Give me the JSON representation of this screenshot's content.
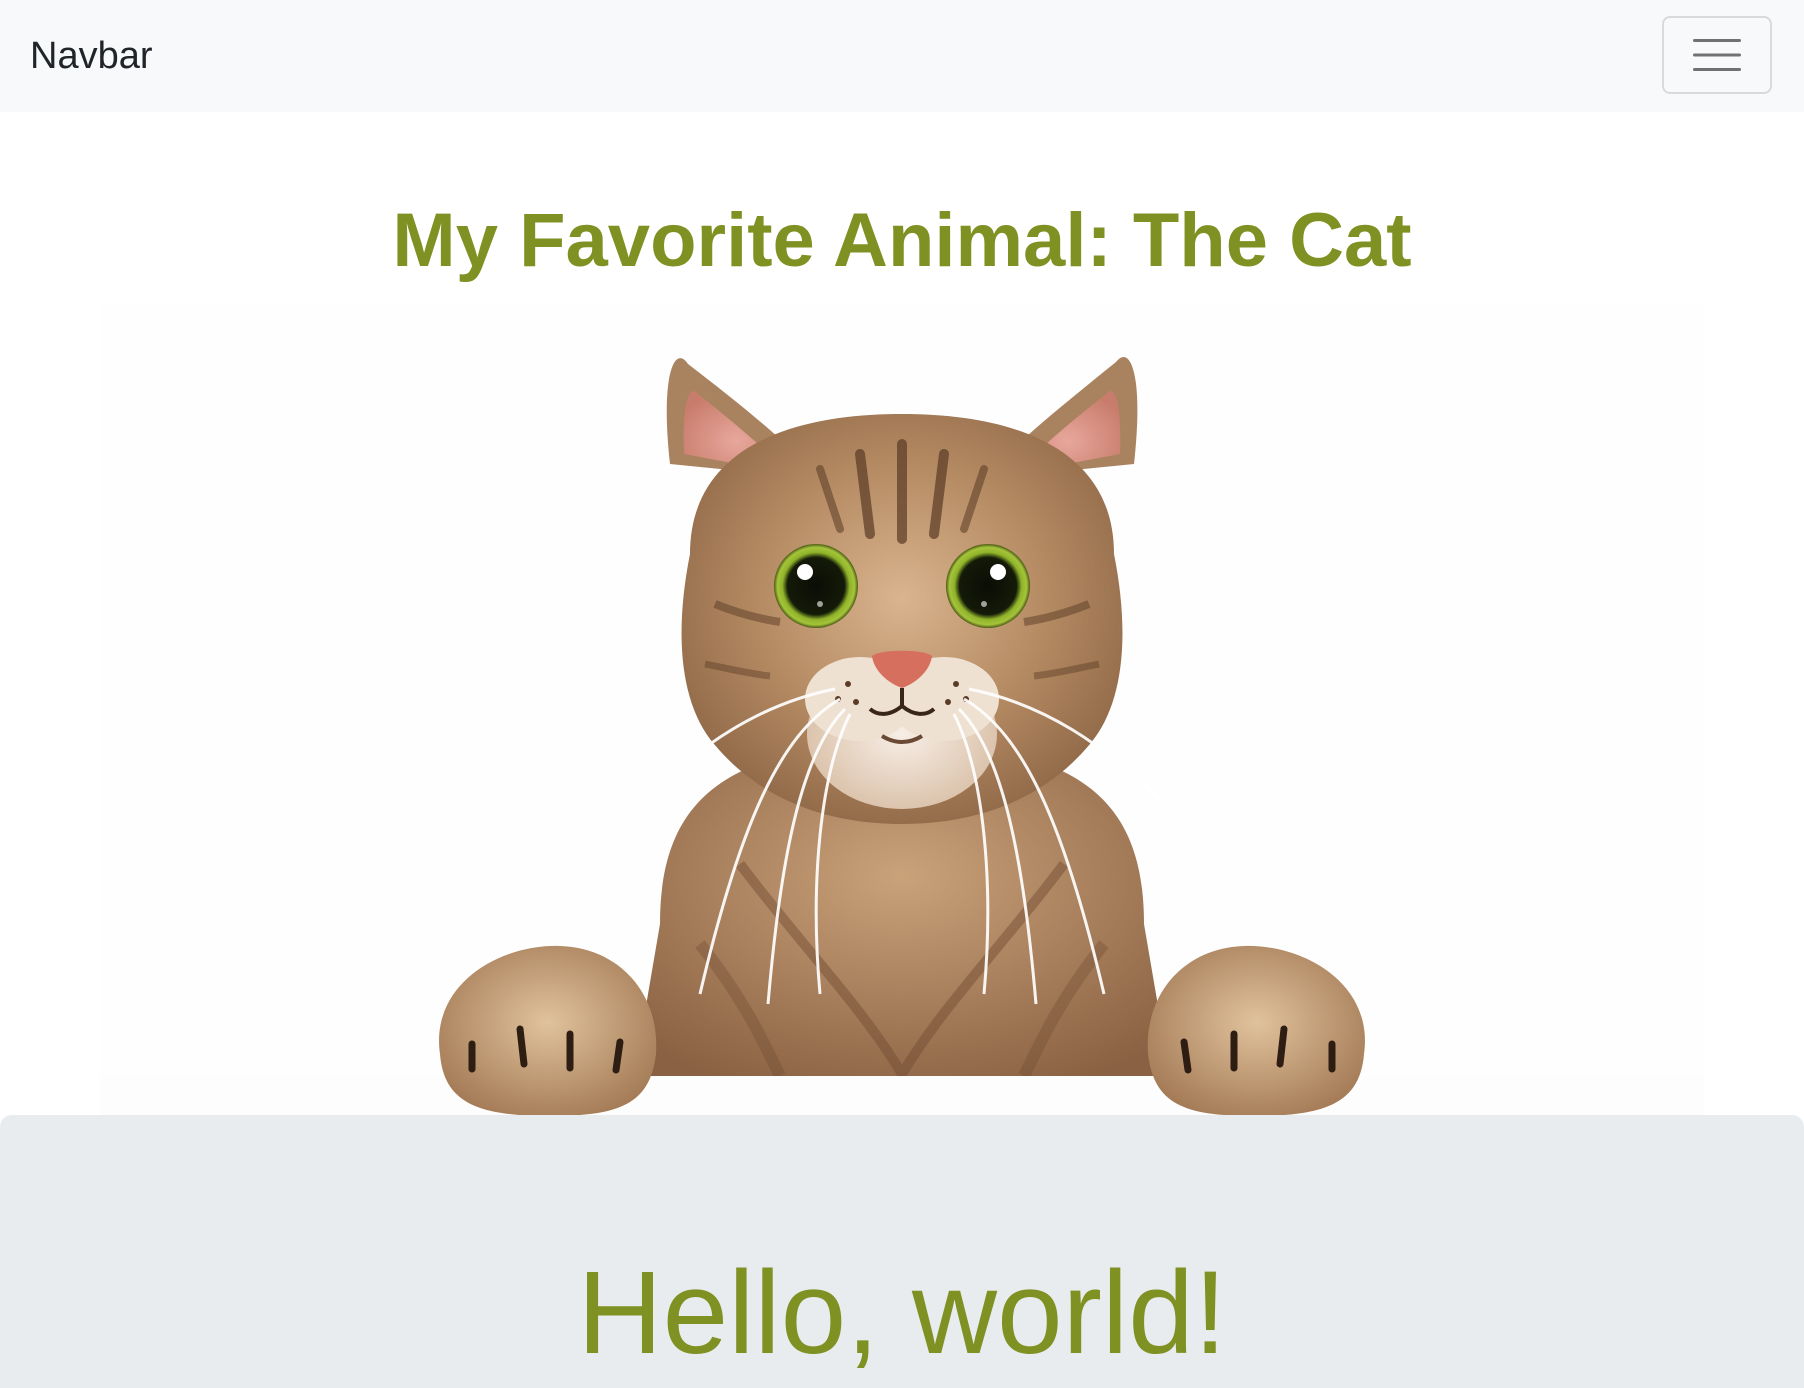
{
  "navbar": {
    "brand": "Navbar",
    "toggler_icon": "hamburger-menu-icon"
  },
  "main": {
    "title": "My Favorite Animal: The Cat",
    "image_icon": "cat-photo"
  },
  "jumbotron": {
    "heading": "Hello, world!"
  },
  "colors": {
    "accent": "#7f9122",
    "navbar_bg": "#f8f9fa",
    "jumbotron_bg": "#e9ecef",
    "brand_text": "#212529"
  }
}
